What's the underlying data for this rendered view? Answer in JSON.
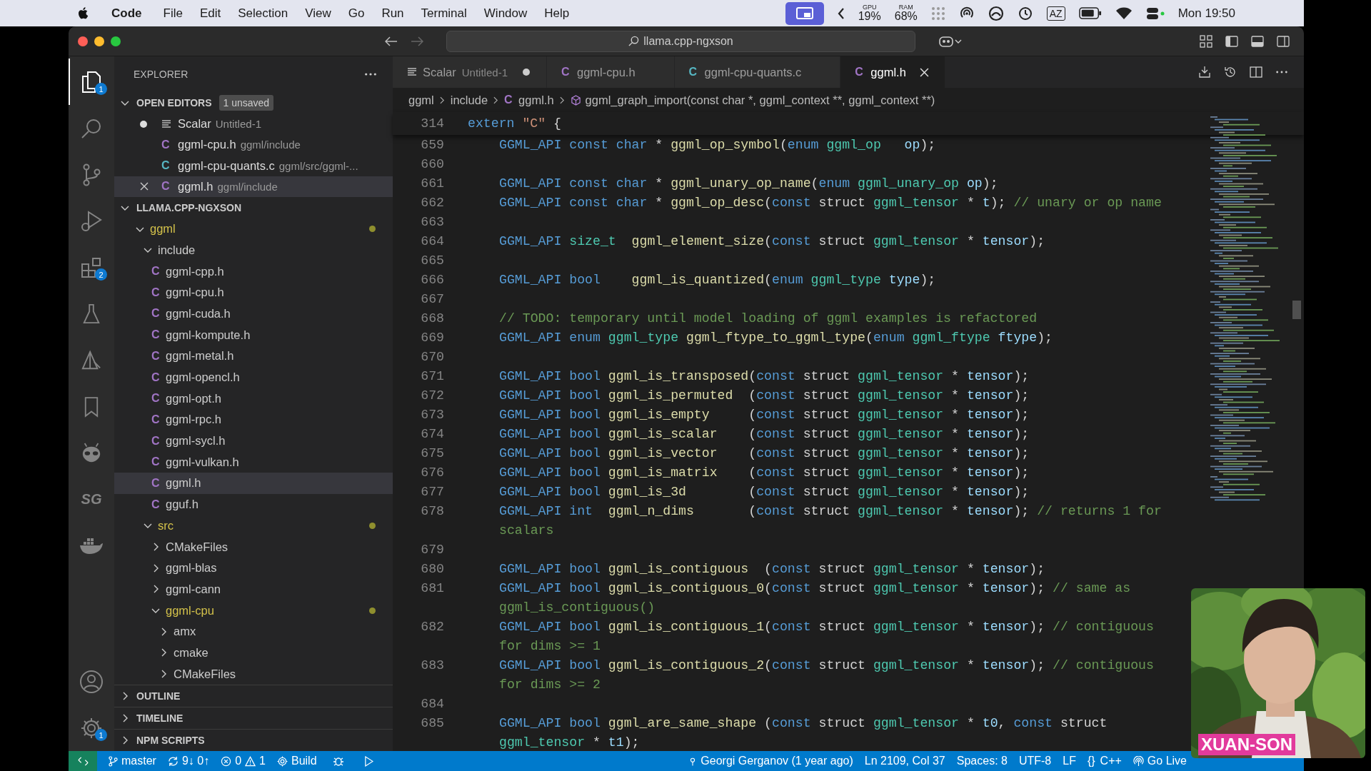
{
  "menu_bar": {
    "app": "Code",
    "items": [
      "File",
      "Edit",
      "Selection",
      "View",
      "Go",
      "Run",
      "Terminal",
      "Window",
      "Help"
    ],
    "gpu": {
      "label": "GPU",
      "value": "19%"
    },
    "ram": {
      "label": "RAM",
      "value": "68%"
    },
    "input_source": "AZ",
    "clock": "Mon 19:50"
  },
  "title_bar": {
    "search": "llama.cpp-ngxson"
  },
  "activity_bar": {
    "items": [
      {
        "kind": "explorer",
        "selected": true,
        "badge": "1"
      },
      {
        "kind": "search",
        "selected": false
      },
      {
        "kind": "source-control",
        "selected": false
      },
      {
        "kind": "run-debug",
        "selected": false
      },
      {
        "kind": "extensions",
        "selected": false,
        "badge": "2"
      },
      {
        "kind": "testing",
        "selected": false
      },
      {
        "kind": "tools",
        "selected": false
      },
      {
        "kind": "bookmarks",
        "selected": false
      },
      {
        "kind": "alien",
        "selected": false
      },
      {
        "kind": "sg",
        "selected": false,
        "text": "SG"
      },
      {
        "kind": "docker",
        "selected": false
      }
    ],
    "bottom": [
      {
        "kind": "account"
      },
      {
        "kind": "settings",
        "badge": "1"
      }
    ]
  },
  "sidebar": {
    "title": "EXPLORER",
    "open_editors": {
      "title": "OPEN EDITORS",
      "badge": "1 unsaved",
      "expanded": true,
      "items": [
        {
          "name": "Scalar",
          "description": "Untitled-1",
          "kind": "text",
          "dirty": true,
          "selected": false
        },
        {
          "name": "ggml-cpu.h",
          "description": "ggml/include",
          "kind": "c-header",
          "icon": "C",
          "dirty": false,
          "selected": false
        },
        {
          "name": "ggml-cpu-quants.c",
          "description": "ggml/src/ggml-...",
          "kind": "c-source",
          "icon": "C",
          "dirty": false,
          "selected": false
        },
        {
          "name": "ggml.h",
          "description": "ggml/include",
          "kind": "c-header",
          "icon": "C",
          "dirty": false,
          "selected": true
        }
      ]
    },
    "workspace": {
      "title": "LLAMA.CPP-NGXSON",
      "expanded": true,
      "tree": [
        {
          "name": "ggml",
          "kind": "folder",
          "expanded": true,
          "modified": true,
          "selected": false,
          "children": [
            {
              "name": "include",
              "kind": "folder",
              "expanded": true,
              "modified": false,
              "selected": false,
              "children": [
                {
                  "name": "ggml-cpp.h",
                  "kind": "c-header",
                  "icon": "C",
                  "modified": false,
                  "selected": false
                },
                {
                  "name": "ggml-cpu.h",
                  "kind": "c-header",
                  "icon": "C",
                  "modified": false,
                  "selected": false
                },
                {
                  "name": "ggml-cuda.h",
                  "kind": "c-header",
                  "icon": "C",
                  "modified": false,
                  "selected": false
                },
                {
                  "name": "ggml-kompute.h",
                  "kind": "c-header",
                  "icon": "C",
                  "modified": false,
                  "selected": false
                },
                {
                  "name": "ggml-metal.h",
                  "kind": "c-header",
                  "icon": "C",
                  "modified": false,
                  "selected": false
                },
                {
                  "name": "ggml-opencl.h",
                  "kind": "c-header",
                  "icon": "C",
                  "modified": false,
                  "selected": false
                },
                {
                  "name": "ggml-opt.h",
                  "kind": "c-header",
                  "icon": "C",
                  "modified": false,
                  "selected": false
                },
                {
                  "name": "ggml-rpc.h",
                  "kind": "c-header",
                  "icon": "C",
                  "modified": false,
                  "selected": false
                },
                {
                  "name": "ggml-sycl.h",
                  "kind": "c-header",
                  "icon": "C",
                  "modified": false,
                  "selected": false
                },
                {
                  "name": "ggml-vulkan.h",
                  "kind": "c-header",
                  "icon": "C",
                  "modified": false,
                  "selected": false
                },
                {
                  "name": "ggml.h",
                  "kind": "c-header",
                  "icon": "C",
                  "modified": false,
                  "selected": true
                },
                {
                  "name": "gguf.h",
                  "kind": "c-header",
                  "icon": "C",
                  "modified": false,
                  "selected": false
                }
              ]
            },
            {
              "name": "src",
              "kind": "folder",
              "expanded": true,
              "modified": true,
              "selected": false,
              "children": [
                {
                  "name": "CMakeFiles",
                  "kind": "folder",
                  "expanded": false,
                  "modified": false,
                  "selected": false
                },
                {
                  "name": "ggml-blas",
                  "kind": "folder",
                  "expanded": false,
                  "modified": false,
                  "selected": false
                },
                {
                  "name": "ggml-cann",
                  "kind": "folder",
                  "expanded": false,
                  "modified": false,
                  "selected": false
                },
                {
                  "name": "ggml-cpu",
                  "kind": "folder",
                  "expanded": true,
                  "modified": true,
                  "selected": false,
                  "children": [
                    {
                      "name": "amx",
                      "kind": "folder",
                      "expanded": false,
                      "modified": false,
                      "selected": false
                    },
                    {
                      "name": "cmake",
                      "kind": "folder",
                      "expanded": false,
                      "modified": false,
                      "selected": false
                    },
                    {
                      "name": "CMakeFiles",
                      "kind": "folder",
                      "expanded": false,
                      "modified": false,
                      "selected": false
                    }
                  ]
                }
              ]
            }
          ]
        }
      ]
    },
    "panels": [
      {
        "title": "OUTLINE",
        "expanded": false
      },
      {
        "title": "TIMELINE",
        "expanded": false
      },
      {
        "title": "NPM SCRIPTS",
        "expanded": false
      }
    ]
  },
  "editor": {
    "tabs": [
      {
        "label": "Scalar",
        "description": "Untitled-1",
        "kind": "text",
        "dirty": true,
        "selected": false
      },
      {
        "label": "ggml-cpu.h",
        "kind": "c-header",
        "icon": "C",
        "dirty": false,
        "selected": false
      },
      {
        "label": "ggml-cpu-quants.c",
        "kind": "c-source",
        "icon": "C",
        "dirty": false,
        "selected": false
      },
      {
        "label": "ggml.h",
        "kind": "c-header",
        "icon": "C",
        "dirty": false,
        "selected": true
      }
    ],
    "breadcrumb": [
      {
        "kind": "folder",
        "text": "ggml"
      },
      {
        "kind": "folder",
        "text": "include"
      },
      {
        "kind": "c-header",
        "icon": "C",
        "text": "ggml.h"
      },
      {
        "kind": "symbol",
        "text": "ggml_graph_import(const char *, ggml_context **, ggml_context **)"
      }
    ],
    "sticky": {
      "number": "314",
      "tokens": [
        {
          "kind": "keyword",
          "text": "extern "
        },
        {
          "kind": "string",
          "text": "\"C\""
        },
        {
          "kind": "plain",
          "text": " {"
        }
      ]
    },
    "lines": [
      {
        "number": "659",
        "rows": [
          {
            "tokens": [
              {
                "kind": "keyword",
                "text": "GGML_API const char"
              },
              {
                "kind": "plain",
                "text": " * "
              },
              {
                "kind": "function",
                "text": "ggml_op_symbol"
              },
              {
                "kind": "plain",
                "text": "("
              },
              {
                "kind": "keyword",
                "text": "enum "
              },
              {
                "kind": "type",
                "text": "ggml_op   "
              },
              {
                "kind": "param",
                "text": "op"
              },
              {
                "kind": "plain",
                "text": ");"
              }
            ]
          }
        ]
      },
      {
        "number": "660"
      },
      {
        "number": "661",
        "rows": [
          {
            "tokens": [
              {
                "kind": "keyword",
                "text": "GGML_API const char"
              },
              {
                "kind": "plain",
                "text": " * "
              },
              {
                "kind": "function",
                "text": "ggml_unary_op_name"
              },
              {
                "kind": "plain",
                "text": "("
              },
              {
                "kind": "keyword",
                "text": "enum "
              },
              {
                "kind": "type",
                "text": "ggml_unary_op "
              },
              {
                "kind": "param",
                "text": "op"
              },
              {
                "kind": "plain",
                "text": ");"
              }
            ]
          }
        ]
      },
      {
        "number": "662",
        "rows": [
          {
            "tokens": [
              {
                "kind": "keyword",
                "text": "GGML_API const char"
              },
              {
                "kind": "plain",
                "text": " * "
              },
              {
                "kind": "function",
                "text": "ggml_op_desc"
              },
              {
                "kind": "plain",
                "text": "("
              },
              {
                "kind": "keyword",
                "text": "const"
              },
              {
                "kind": "plain",
                "text": " struct "
              },
              {
                "kind": "type",
                "text": "ggml_tensor"
              },
              {
                "kind": "plain",
                "text": " * "
              },
              {
                "kind": "param",
                "text": "t"
              },
              {
                "kind": "plain",
                "text": "); "
              },
              {
                "kind": "comment",
                "text": "// unary or op name"
              }
            ]
          }
        ]
      },
      {
        "number": "663"
      },
      {
        "number": "664",
        "rows": [
          {
            "tokens": [
              {
                "kind": "keyword",
                "text": "GGML_API "
              },
              {
                "kind": "type",
                "text": "size_t  "
              },
              {
                "kind": "function",
                "text": "ggml_element_size"
              },
              {
                "kind": "plain",
                "text": "("
              },
              {
                "kind": "keyword",
                "text": "const"
              },
              {
                "kind": "plain",
                "text": " struct "
              },
              {
                "kind": "type",
                "text": "ggml_tensor"
              },
              {
                "kind": "plain",
                "text": " * "
              },
              {
                "kind": "param",
                "text": "tensor"
              },
              {
                "kind": "plain",
                "text": ");"
              }
            ]
          }
        ]
      },
      {
        "number": "665"
      },
      {
        "number": "666",
        "rows": [
          {
            "tokens": [
              {
                "kind": "keyword",
                "text": "GGML_API bool    "
              },
              {
                "kind": "function",
                "text": "ggml_is_quantized"
              },
              {
                "kind": "plain",
                "text": "("
              },
              {
                "kind": "keyword",
                "text": "enum "
              },
              {
                "kind": "type",
                "text": "ggml_type "
              },
              {
                "kind": "param",
                "text": "type"
              },
              {
                "kind": "plain",
                "text": ");"
              }
            ]
          }
        ]
      },
      {
        "number": "667"
      },
      {
        "number": "668",
        "rows": [
          {
            "tokens": [
              {
                "kind": "comment",
                "text": "// TODO: temporary until model loading of ggml examples is refactored"
              }
            ]
          }
        ]
      },
      {
        "number": "669",
        "rows": [
          {
            "tokens": [
              {
                "kind": "keyword",
                "text": "GGML_API enum "
              },
              {
                "kind": "type",
                "text": "ggml_type "
              },
              {
                "kind": "function",
                "text": "ggml_ftype_to_ggml_type"
              },
              {
                "kind": "plain",
                "text": "("
              },
              {
                "kind": "keyword",
                "text": "enum "
              },
              {
                "kind": "type",
                "text": "ggml_ftype "
              },
              {
                "kind": "param",
                "text": "ftype"
              },
              {
                "kind": "plain",
                "text": ");"
              }
            ]
          }
        ]
      },
      {
        "number": "670"
      },
      {
        "number": "671",
        "rows": [
          {
            "tokens": [
              {
                "kind": "keyword",
                "text": "GGML_API bool "
              },
              {
                "kind": "function",
                "text": "ggml_is_transposed"
              },
              {
                "kind": "plain",
                "text": "("
              },
              {
                "kind": "keyword",
                "text": "const"
              },
              {
                "kind": "plain",
                "text": " struct "
              },
              {
                "kind": "type",
                "text": "ggml_tensor"
              },
              {
                "kind": "plain",
                "text": " * "
              },
              {
                "kind": "param",
                "text": "tensor"
              },
              {
                "kind": "plain",
                "text": ");"
              }
            ]
          }
        ]
      },
      {
        "number": "672",
        "rows": [
          {
            "tokens": [
              {
                "kind": "keyword",
                "text": "GGML_API bool "
              },
              {
                "kind": "function",
                "text": "ggml_is_permuted"
              },
              {
                "kind": "plain",
                "text": "  ("
              },
              {
                "kind": "keyword",
                "text": "const"
              },
              {
                "kind": "plain",
                "text": " struct "
              },
              {
                "kind": "type",
                "text": "ggml_tensor"
              },
              {
                "kind": "plain",
                "text": " * "
              },
              {
                "kind": "param",
                "text": "tensor"
              },
              {
                "kind": "plain",
                "text": ");"
              }
            ]
          }
        ]
      },
      {
        "number": "673",
        "rows": [
          {
            "tokens": [
              {
                "kind": "keyword",
                "text": "GGML_API bool "
              },
              {
                "kind": "function",
                "text": "ggml_is_empty"
              },
              {
                "kind": "plain",
                "text": "     ("
              },
              {
                "kind": "keyword",
                "text": "const"
              },
              {
                "kind": "plain",
                "text": " struct "
              },
              {
                "kind": "type",
                "text": "ggml_tensor"
              },
              {
                "kind": "plain",
                "text": " * "
              },
              {
                "kind": "param",
                "text": "tensor"
              },
              {
                "kind": "plain",
                "text": ");"
              }
            ]
          }
        ]
      },
      {
        "number": "674",
        "rows": [
          {
            "tokens": [
              {
                "kind": "keyword",
                "text": "GGML_API bool "
              },
              {
                "kind": "function",
                "text": "ggml_is_scalar"
              },
              {
                "kind": "plain",
                "text": "    ("
              },
              {
                "kind": "keyword",
                "text": "const"
              },
              {
                "kind": "plain",
                "text": " struct "
              },
              {
                "kind": "type",
                "text": "ggml_tensor"
              },
              {
                "kind": "plain",
                "text": " * "
              },
              {
                "kind": "param",
                "text": "tensor"
              },
              {
                "kind": "plain",
                "text": ");"
              }
            ]
          }
        ]
      },
      {
        "number": "675",
        "rows": [
          {
            "tokens": [
              {
                "kind": "keyword",
                "text": "GGML_API bool "
              },
              {
                "kind": "function",
                "text": "ggml_is_vector"
              },
              {
                "kind": "plain",
                "text": "    ("
              },
              {
                "kind": "keyword",
                "text": "const"
              },
              {
                "kind": "plain",
                "text": " struct "
              },
              {
                "kind": "type",
                "text": "ggml_tensor"
              },
              {
                "kind": "plain",
                "text": " * "
              },
              {
                "kind": "param",
                "text": "tensor"
              },
              {
                "kind": "plain",
                "text": ");"
              }
            ]
          }
        ]
      },
      {
        "number": "676",
        "rows": [
          {
            "tokens": [
              {
                "kind": "keyword",
                "text": "GGML_API bool "
              },
              {
                "kind": "function",
                "text": "ggml_is_matrix"
              },
              {
                "kind": "plain",
                "text": "    ("
              },
              {
                "kind": "keyword",
                "text": "const"
              },
              {
                "kind": "plain",
                "text": " struct "
              },
              {
                "kind": "type",
                "text": "ggml_tensor"
              },
              {
                "kind": "plain",
                "text": " * "
              },
              {
                "kind": "param",
                "text": "tensor"
              },
              {
                "kind": "plain",
                "text": ");"
              }
            ]
          }
        ]
      },
      {
        "number": "677",
        "rows": [
          {
            "tokens": [
              {
                "kind": "keyword",
                "text": "GGML_API bool "
              },
              {
                "kind": "function",
                "text": "ggml_is_3d"
              },
              {
                "kind": "plain",
                "text": "        ("
              },
              {
                "kind": "keyword",
                "text": "const"
              },
              {
                "kind": "plain",
                "text": " struct "
              },
              {
                "kind": "type",
                "text": "ggml_tensor"
              },
              {
                "kind": "plain",
                "text": " * "
              },
              {
                "kind": "param",
                "text": "tensor"
              },
              {
                "kind": "plain",
                "text": ");"
              }
            ]
          }
        ]
      },
      {
        "number": "678",
        "rows": [
          {
            "tokens": [
              {
                "kind": "keyword",
                "text": "GGML_API int  "
              },
              {
                "kind": "function",
                "text": "ggml_n_dims"
              },
              {
                "kind": "plain",
                "text": "       ("
              },
              {
                "kind": "keyword",
                "text": "const"
              },
              {
                "kind": "plain",
                "text": " struct "
              },
              {
                "kind": "type",
                "text": "ggml_tensor"
              },
              {
                "kind": "plain",
                "text": " * "
              },
              {
                "kind": "param",
                "text": "tensor"
              },
              {
                "kind": "plain",
                "text": "); "
              },
              {
                "kind": "comment",
                "text": "// returns 1 for"
              }
            ]
          },
          {
            "tokens": [
              {
                "kind": "comment",
                "text": "scalars"
              }
            ]
          }
        ]
      },
      {
        "number": "679"
      },
      {
        "number": "680",
        "rows": [
          {
            "tokens": [
              {
                "kind": "keyword",
                "text": "GGML_API bool "
              },
              {
                "kind": "function",
                "text": "ggml_is_contiguous"
              },
              {
                "kind": "plain",
                "text": "  ("
              },
              {
                "kind": "keyword",
                "text": "const"
              },
              {
                "kind": "plain",
                "text": " struct "
              },
              {
                "kind": "type",
                "text": "ggml_tensor"
              },
              {
                "kind": "plain",
                "text": " * "
              },
              {
                "kind": "param",
                "text": "tensor"
              },
              {
                "kind": "plain",
                "text": ");"
              }
            ]
          }
        ]
      },
      {
        "number": "681",
        "rows": [
          {
            "tokens": [
              {
                "kind": "keyword",
                "text": "GGML_API bool "
              },
              {
                "kind": "function",
                "text": "ggml_is_contiguous_0"
              },
              {
                "kind": "plain",
                "text": "("
              },
              {
                "kind": "keyword",
                "text": "const"
              },
              {
                "kind": "plain",
                "text": " struct "
              },
              {
                "kind": "type",
                "text": "ggml_tensor"
              },
              {
                "kind": "plain",
                "text": " * "
              },
              {
                "kind": "param",
                "text": "tensor"
              },
              {
                "kind": "plain",
                "text": "); "
              },
              {
                "kind": "comment",
                "text": "// same as"
              }
            ]
          },
          {
            "tokens": [
              {
                "kind": "comment",
                "text": "ggml_is_contiguous()"
              }
            ]
          }
        ]
      },
      {
        "number": "682",
        "rows": [
          {
            "tokens": [
              {
                "kind": "keyword",
                "text": "GGML_API bool "
              },
              {
                "kind": "function",
                "text": "ggml_is_contiguous_1"
              },
              {
                "kind": "plain",
                "text": "("
              },
              {
                "kind": "keyword",
                "text": "const"
              },
              {
                "kind": "plain",
                "text": " struct "
              },
              {
                "kind": "type",
                "text": "ggml_tensor"
              },
              {
                "kind": "plain",
                "text": " * "
              },
              {
                "kind": "param",
                "text": "tensor"
              },
              {
                "kind": "plain",
                "text": "); "
              },
              {
                "kind": "comment",
                "text": "// contiguous"
              }
            ]
          },
          {
            "tokens": [
              {
                "kind": "comment",
                "text": "for dims >= 1"
              }
            ]
          }
        ]
      },
      {
        "number": "683",
        "rows": [
          {
            "tokens": [
              {
                "kind": "keyword",
                "text": "GGML_API bool "
              },
              {
                "kind": "function",
                "text": "ggml_is_contiguous_2"
              },
              {
                "kind": "plain",
                "text": "("
              },
              {
                "kind": "keyword",
                "text": "const"
              },
              {
                "kind": "plain",
                "text": " struct "
              },
              {
                "kind": "type",
                "text": "ggml_tensor"
              },
              {
                "kind": "plain",
                "text": " * "
              },
              {
                "kind": "param",
                "text": "tensor"
              },
              {
                "kind": "plain",
                "text": "); "
              },
              {
                "kind": "comment",
                "text": "// contiguous"
              }
            ]
          },
          {
            "tokens": [
              {
                "kind": "comment",
                "text": "for dims >= 2"
              }
            ]
          }
        ]
      },
      {
        "number": "684"
      },
      {
        "number": "685",
        "rows": [
          {
            "tokens": [
              {
                "kind": "keyword",
                "text": "GGML_API bool "
              },
              {
                "kind": "function",
                "text": "ggml_are_same_shape"
              },
              {
                "kind": "plain",
                "text": " ("
              },
              {
                "kind": "keyword",
                "text": "const"
              },
              {
                "kind": "plain",
                "text": " struct "
              },
              {
                "kind": "type",
                "text": "ggml_tensor"
              },
              {
                "kind": "plain",
                "text": " * "
              },
              {
                "kind": "param",
                "text": "t0"
              },
              {
                "kind": "plain",
                "text": ", "
              },
              {
                "kind": "keyword",
                "text": "const"
              },
              {
                "kind": "plain",
                "text": " struct"
              }
            ]
          },
          {
            "tokens": [
              {
                "kind": "type",
                "text": "ggml_tensor"
              },
              {
                "kind": "plain",
                "text": " * "
              },
              {
                "kind": "param",
                "text": "t1"
              },
              {
                "kind": "plain",
                "text": ");"
              }
            ]
          }
        ]
      }
    ]
  },
  "status_bar": {
    "branch": "master",
    "sync": "9↓ 0↑",
    "errors": "0",
    "warnings": "1",
    "build": "Build",
    "blame": "Georgi Gerganov (1 year ago)",
    "position": "Ln 2109, Col 37",
    "indent": "Spaces: 8",
    "encoding": "UTF-8",
    "eol": "LF",
    "language_icon": "{}",
    "language": "C++",
    "live": "Go Live"
  },
  "webcam": {
    "kind": "picture",
    "label": "XUAN-SON"
  }
}
